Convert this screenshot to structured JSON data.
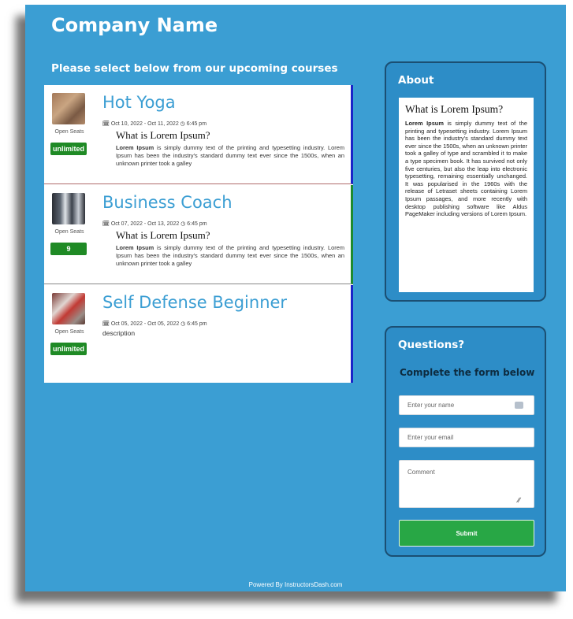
{
  "header": {
    "company_name": "Company Name"
  },
  "courses_section": {
    "heading": "Please select below from our upcoming courses"
  },
  "courses": [
    {
      "title": "Hot Yoga",
      "dates": "Oct 10, 2022 - Oct 11, 2022",
      "time": "6:45 pm",
      "seats_label": "Open Seats",
      "seats": "unlimited",
      "desc_heading": "What is Lorem Ipsum?",
      "desc_strong": "Lorem Ipsum",
      "desc_rest": " is simply dummy text of the printing and typesetting industry. Lorem Ipsum has been the industry's standard dummy text ever since the 1500s, when an unknown printer took a galley"
    },
    {
      "title": "Business Coach",
      "dates": "Oct 07, 2022 - Oct 13, 2022",
      "time": "6:45 pm",
      "seats_label": "Open Seats",
      "seats": "9",
      "desc_heading": "What is Lorem Ipsum?",
      "desc_strong": "Lorem Ipsum",
      "desc_rest": " is simply dummy text of the printing and typesetting industry. Lorem Ipsum has been the industry's standard dummy text ever since the 1500s, when an unknown printer took a galley"
    },
    {
      "title": "Self Defense Beginner",
      "dates": "Oct 05, 2022 - Oct 05, 2022",
      "time": "6:45 pm",
      "seats_label": "Open Seats",
      "seats": "unlimited",
      "description": "description"
    }
  ],
  "about": {
    "title": "About",
    "heading": "What is Lorem Ipsum?",
    "body_strong": "Lorem Ipsum",
    "body_rest": " is simply dummy text of the printing and typesetting industry. Lorem Ipsum has been the industry's standard dummy text ever since the 1500s, when an unknown printer took a galley of type and scrambled it to make a type specimen book. It has survived not only five centuries, but also the leap into electronic typesetting, remaining essentially unchanged. It was popularised in the 1960s with the release of Letraset sheets containing Lorem Ipsum passages, and more recently with desktop publishing software like Aldus PageMaker including versions of Lorem Ipsum."
  },
  "questions": {
    "title": "Questions?",
    "subtitle": "Complete the form below",
    "name_placeholder": "Enter your name",
    "email_placeholder": "Enter your email",
    "comment_placeholder": "Comment",
    "submit_label": "Submit"
  },
  "footer": {
    "powered": "Powered By InstructorsDash.com"
  },
  "colors": {
    "page_bg": "#3b9ed3",
    "card_bg": "#2d8dc7",
    "title_blue": "#3b9ed3",
    "badge_green": "#1f8a25",
    "submit_green": "#28a745"
  },
  "icons": {
    "date": "calendar-icon",
    "time": "clock-icon",
    "name_field": "autofill-icon",
    "resize": "resize-handle-icon"
  }
}
